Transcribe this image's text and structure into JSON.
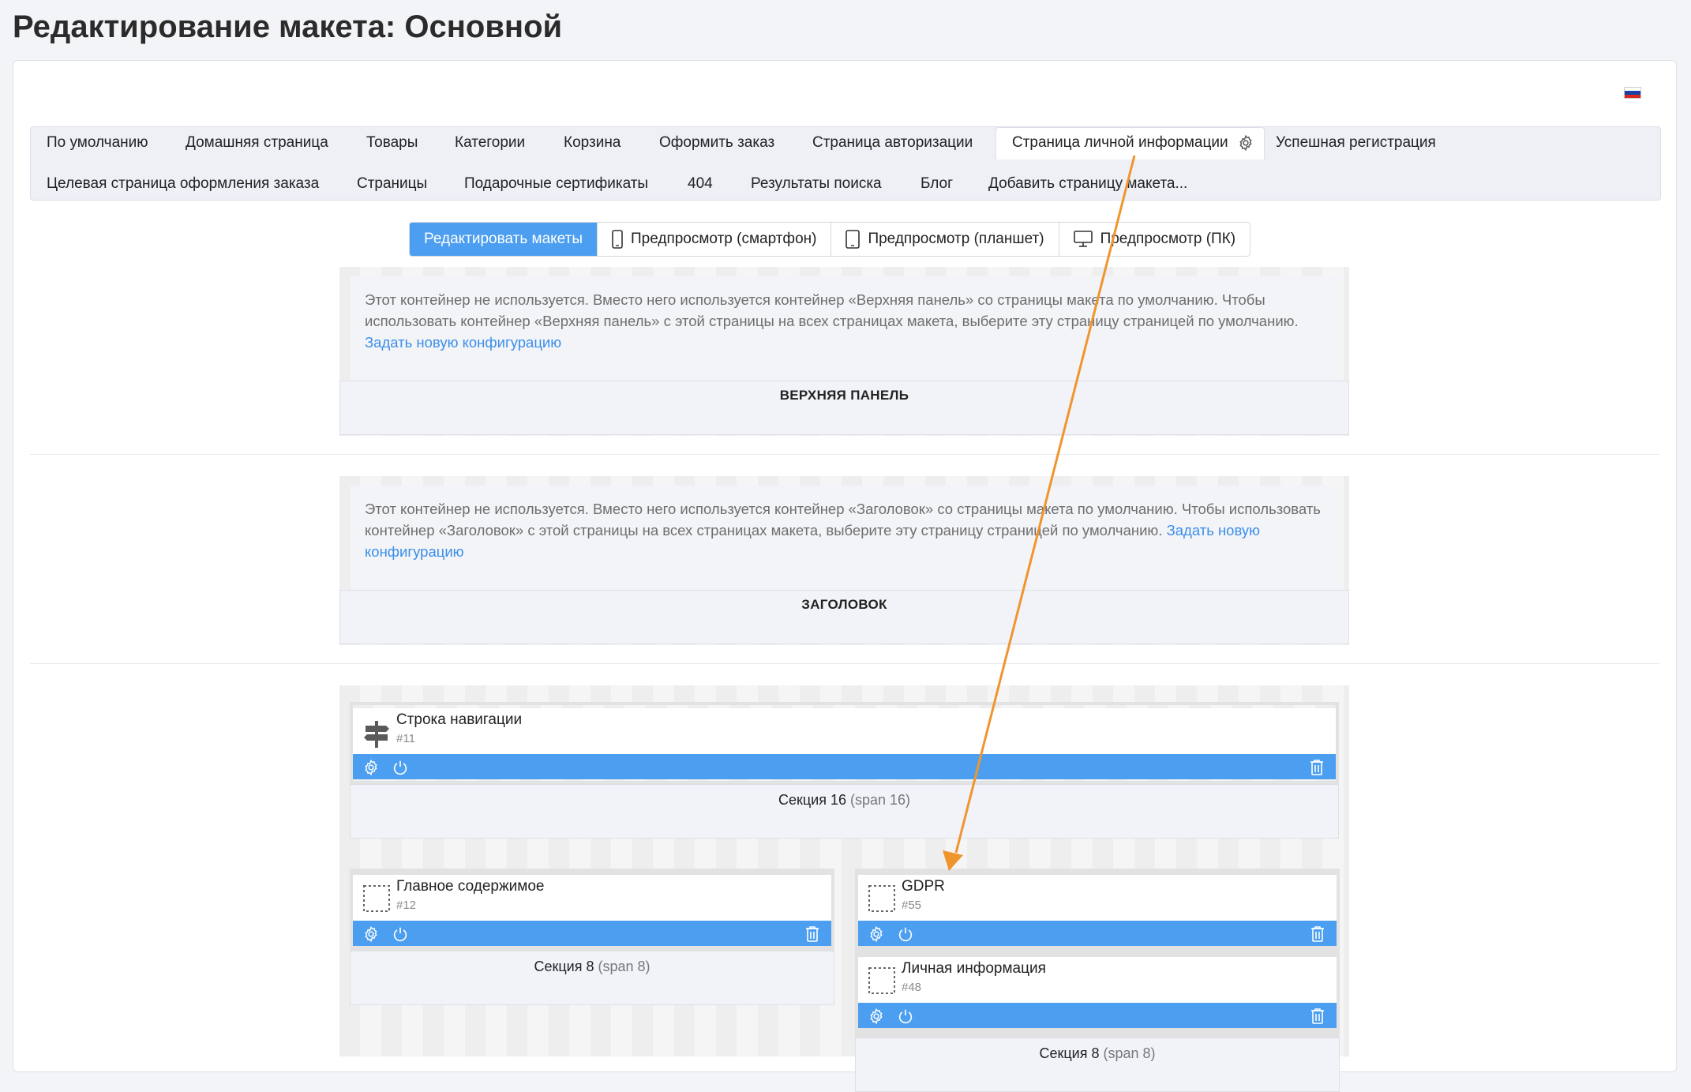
{
  "page": {
    "title": "Редактирование макета: Основной"
  },
  "language": {
    "flag_icon": "russian-flag-icon",
    "flag_colors": [
      "#ffffff",
      "#1c3fa8",
      "#d52b1e"
    ]
  },
  "layout_tabs": [
    {
      "label": "По умолчанию"
    },
    {
      "label": "Домашняя страница"
    },
    {
      "label": "Товары"
    },
    {
      "label": "Категории"
    },
    {
      "label": "Корзина"
    },
    {
      "label": "Оформить заказ"
    },
    {
      "label": "Страница авторизации"
    },
    {
      "label": "Страница личной информации",
      "active": true,
      "icon": "gear-icon"
    },
    {
      "label": "Успешная регистрация"
    },
    {
      "label": "Целевая страница оформления заказа"
    },
    {
      "label": "Страницы"
    },
    {
      "label": "Подарочные сертификаты"
    },
    {
      "label": "404"
    },
    {
      "label": "Результаты поиска"
    },
    {
      "label": "Блог"
    },
    {
      "label": "Добавить страницу макета..."
    }
  ],
  "modes": [
    {
      "label": "Редактировать макеты",
      "active": true
    },
    {
      "label": "Предпросмотр (смартфон)",
      "icon": "smartphone-icon"
    },
    {
      "label": "Предпросмотр (планшет)",
      "icon": "tablet-icon"
    },
    {
      "label": "Предпросмотр (ПК)",
      "icon": "desktop-icon"
    }
  ],
  "containers": {
    "top_panel": {
      "notice": "Этот контейнер не используется. Вместо него используется контейнер «Верхняя панель» со страницы макета по умолчанию. Чтобы использовать контейнер «Верхняя панель» с этой страницы на всех страницах макета, выберите эту страницу страницей по умолчанию.",
      "link": "Задать новую конфигурацию",
      "name": "ВЕРХНЯЯ ПАНЕЛЬ"
    },
    "header": {
      "notice": "Этот контейнер не используется. Вместо него используется контейнер «Заголовок» со страницы макета по умолчанию. Чтобы использовать контейнер «Заголовок» с этой страницы на всех страницах макета, выберите эту страницу страницей по умолчанию.",
      "link": "Задать новую конфигурацию",
      "name": "ЗАГОЛОВОК"
    }
  },
  "sections": {
    "breadcrumbs_section": {
      "footer": "Секция 16",
      "span": "(span 16)",
      "block": {
        "title": "Строка навигации",
        "id": "#11",
        "icon": "signpost-icon"
      }
    },
    "main_section": {
      "footer": "Секция 8",
      "span": "(span 8)",
      "block": {
        "title": "Главное содержимое",
        "id": "#12",
        "icon": "placeholder-block-icon"
      }
    },
    "side_section": {
      "footer": "Секция 8",
      "span": "(span 8)",
      "blocks": [
        {
          "title": "GDPR",
          "id": "#55",
          "icon": "placeholder-block-icon"
        },
        {
          "title": "Личная информация",
          "id": "#48",
          "icon": "placeholder-block-icon"
        }
      ]
    }
  },
  "block_bar_icons": [
    "gear-icon",
    "power-icon",
    "trash-icon"
  ],
  "colors": {
    "accent": "#4c9ef0",
    "annotation_arrow": "#f0952e",
    "link": "#3b8ee8"
  }
}
